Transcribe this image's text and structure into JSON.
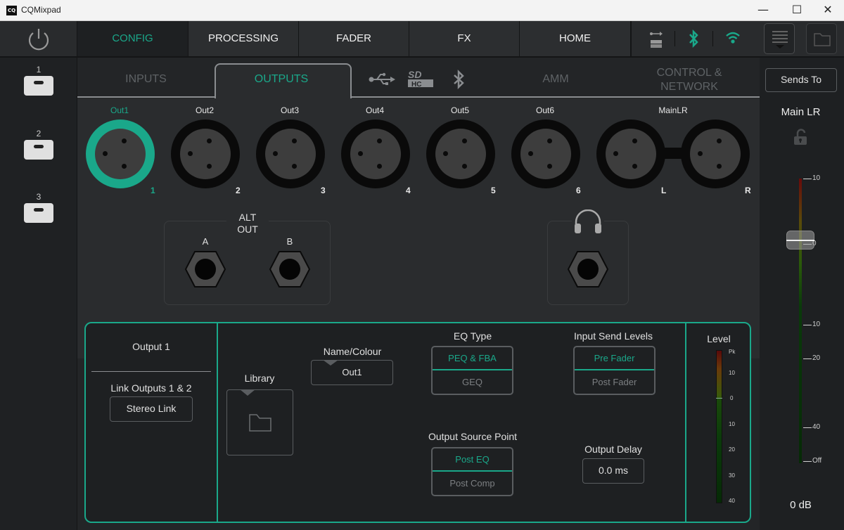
{
  "window": {
    "title": "CQMixpad",
    "logo_text": "CQ",
    "controls": {
      "minimize": "—",
      "maximize": "☐",
      "close": "✕"
    }
  },
  "topnav": {
    "tabs": [
      {
        "label": "CONFIG",
        "active": true
      },
      {
        "label": "PROCESSING",
        "active": false
      },
      {
        "label": "FADER",
        "active": false
      },
      {
        "label": "FX",
        "active": false
      },
      {
        "label": "HOME",
        "active": false
      }
    ],
    "status_icons": [
      "usb-sd-icon",
      "bluetooth-icon",
      "wifi-icon"
    ]
  },
  "sidebar": {
    "scenes": [
      {
        "label": "1"
      },
      {
        "label": "2"
      },
      {
        "label": "3"
      }
    ]
  },
  "subtabs": {
    "items": [
      {
        "label": "INPUTS",
        "active": false
      },
      {
        "label": "OUTPUTS",
        "active": true
      },
      {
        "label": "AMM",
        "active": false
      },
      {
        "label": "CONTROL &",
        "label2": "NETWORK",
        "active": false
      }
    ]
  },
  "outputs": {
    "connectors": [
      {
        "label": "Out1",
        "number": "1",
        "selected": true
      },
      {
        "label": "Out2",
        "number": "2",
        "selected": false
      },
      {
        "label": "Out3",
        "number": "3",
        "selected": false
      },
      {
        "label": "Out4",
        "number": "4",
        "selected": false
      },
      {
        "label": "Out5",
        "number": "5",
        "selected": false
      },
      {
        "label": "Out6",
        "number": "6",
        "selected": false
      }
    ],
    "main": {
      "label": "MainLR",
      "left": "L",
      "right": "R"
    },
    "alt_out": {
      "title_line1": "ALT",
      "title_line2": "OUT",
      "a": "A",
      "b": "B"
    }
  },
  "detail": {
    "output_name": "Output 1",
    "link_label": "Link Outputs 1 & 2",
    "stereo_link": "Stereo Link",
    "library_label": "Library",
    "name_colour_label": "Name/Colour",
    "name_value": "Out1",
    "eq_type": {
      "label": "EQ Type",
      "options": [
        "PEQ & FBA",
        "GEQ"
      ],
      "selected": "PEQ & FBA"
    },
    "send_levels": {
      "label": "Input Send Levels",
      "options": [
        "Pre Fader",
        "Post Fader"
      ],
      "selected": "Pre Fader"
    },
    "source_point": {
      "label": "Output Source Point",
      "options": [
        "Post EQ",
        "Post Comp"
      ],
      "selected": "Post EQ"
    },
    "delay": {
      "label": "Output Delay",
      "value": "0.0 ms"
    },
    "level": {
      "label": "Level",
      "scale": [
        "Pk",
        "10",
        "0",
        "10",
        "20",
        "30",
        "40"
      ]
    }
  },
  "rightpanel": {
    "sends_to": "Sends To",
    "channel": "Main LR",
    "fader_scale": [
      "10",
      "0",
      "10",
      "20",
      "40",
      "Off"
    ],
    "fader_value_db": 0,
    "readout": "0 dB"
  },
  "colors": {
    "accent": "#1aa88a",
    "background": "#1e2022",
    "panel": "#2a2c2e"
  }
}
